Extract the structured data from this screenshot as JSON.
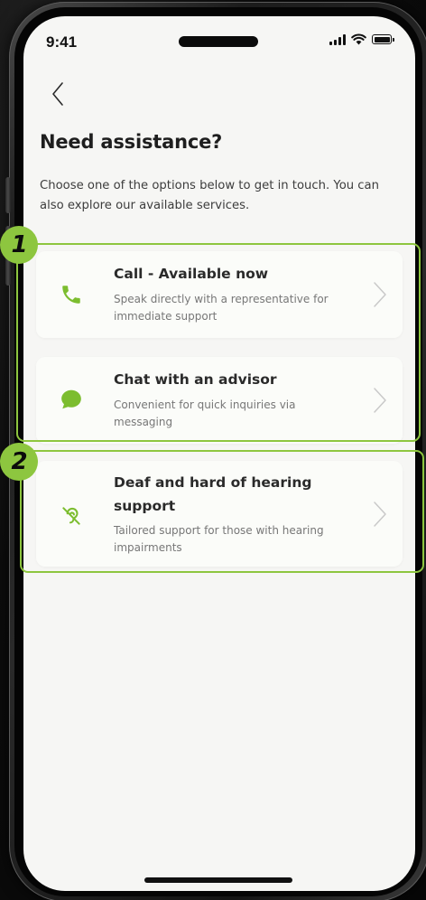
{
  "status_bar": {
    "time": "9:41"
  },
  "header": {
    "back_icon": "chevron-left-icon",
    "title": "Need assistance?",
    "subtitle": "Choose one of the options below to get in touch. You can also explore our available services."
  },
  "options": [
    {
      "icon": "phone-icon",
      "title": "Call - Available now",
      "description": "Speak directly with a representative for immediate support"
    },
    {
      "icon": "chat-bubble-icon",
      "title": "Chat with an advisor",
      "description": "Convenient for quick inquiries via messaging"
    },
    {
      "icon": "hearing-impaired-icon",
      "title_line1": "Deaf and hard of hearing",
      "title_line2": "support",
      "description": "Tailored support for those with hearing impairments"
    }
  ],
  "annotations": {
    "step1": "1",
    "step2": "2"
  },
  "colors": {
    "accent": "#8dc63f",
    "screen_background": "#f6f6f4",
    "card_background": "#fbfcf9",
    "title_text": "#1e1e1e",
    "secondary_text": "#777777"
  }
}
